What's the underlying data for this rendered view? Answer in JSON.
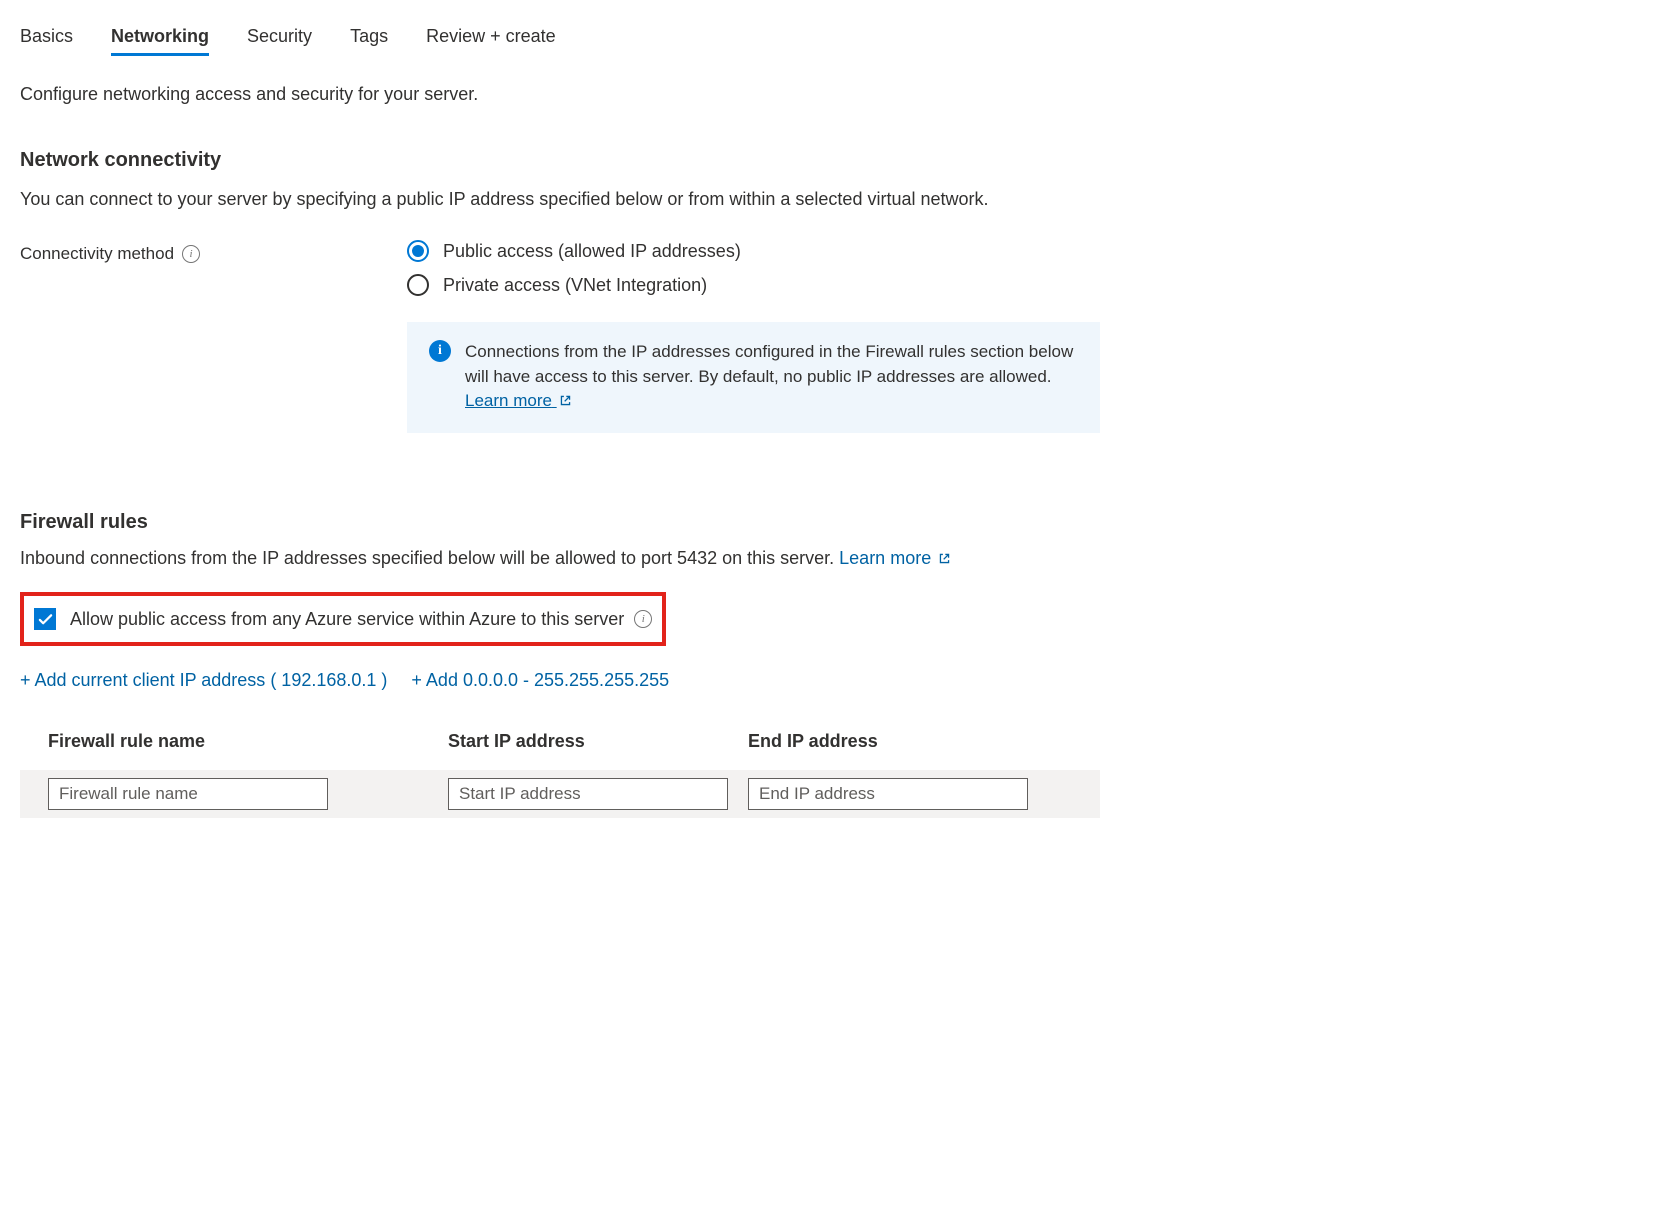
{
  "tabs": {
    "basics": "Basics",
    "networking": "Networking",
    "security": "Security",
    "tags": "Tags",
    "review": "Review + create"
  },
  "intro": "Configure networking access and security for your server.",
  "network_connectivity": {
    "heading": "Network connectivity",
    "description": "You can connect to your server by specifying a public IP address specified below or from within a selected virtual network.",
    "method_label": "Connectivity method",
    "options": {
      "public": "Public access (allowed IP addresses)",
      "private": "Private access (VNet Integration)"
    },
    "info_text": "Connections from the IP addresses configured in the Firewall rules section below will have access to this server. By default, no public IP addresses are allowed. ",
    "info_link": "Learn more"
  },
  "firewall": {
    "heading": "Firewall rules",
    "description_prefix": "Inbound connections from the IP addresses specified below will be allowed to port 5432 on this server. ",
    "learn_more": "Learn more",
    "allow_azure_label": "Allow public access from any Azure service within Azure to this server",
    "add_client_ip": "+ Add current client IP address ( 192.168.0.1 )",
    "add_full_range": "+ Add 0.0.0.0 - 255.255.255.255",
    "columns": {
      "name": "Firewall rule name",
      "start": "Start IP address",
      "end": "End IP address"
    },
    "placeholders": {
      "name": "Firewall rule name",
      "start": "Start IP address",
      "end": "End IP address"
    }
  }
}
